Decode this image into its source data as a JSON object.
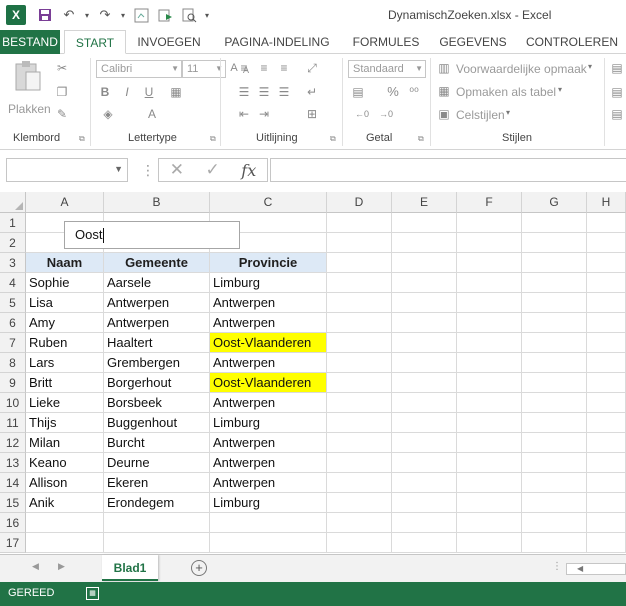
{
  "title_bar": {
    "window_title": "DynamischZoeken.xlsx - Excel",
    "qat_icons": [
      "excel-logo",
      "save-icon",
      "undo-icon",
      "redo-icon",
      "camera-icon",
      "macro-icon",
      "print-preview-icon"
    ]
  },
  "ribbon_tabs": [
    {
      "label": "BESTAND",
      "file": true
    },
    {
      "label": "START",
      "active": true
    },
    {
      "label": "INVOEGEN"
    },
    {
      "label": "PAGINA-INDELING"
    },
    {
      "label": "FORMULES"
    },
    {
      "label": "GEGEVENS"
    },
    {
      "label": "CONTROLEREN"
    }
  ],
  "ribbon": {
    "clipboard": {
      "paste": "Plakken",
      "group": "Klembord"
    },
    "font": {
      "name": "Calibri",
      "size": "11",
      "bold": "B",
      "italic": "I",
      "underline": "U",
      "group": "Lettertype"
    },
    "alignment": {
      "group": "Uitlijning"
    },
    "number": {
      "format": "Standaard",
      "percent": "%",
      "group": "Getal"
    },
    "styles": {
      "conditional": "Voorwaardelijke opmaak",
      "as_table": "Opmaken als tabel",
      "cell_styles": "Celstijlen",
      "group": "Stijlen"
    }
  },
  "formula_bar": {
    "name_box": "",
    "formula": "",
    "fx": "fx"
  },
  "columns": [
    "A",
    "B",
    "C",
    "D",
    "E",
    "F",
    "G",
    "H"
  ],
  "rows": [
    "1",
    "2",
    "3",
    "4",
    "5",
    "6",
    "7",
    "8",
    "9",
    "10",
    "11",
    "12",
    "13",
    "14",
    "15",
    "16",
    "17"
  ],
  "search_box": {
    "value": "Oost"
  },
  "table": {
    "headers": [
      "Naam",
      "Gemeente",
      "Provincie"
    ],
    "rows": [
      {
        "naam": "Sophie",
        "gemeente": "Aarsele",
        "provincie": "Limburg",
        "highlight": false
      },
      {
        "naam": "Lisa",
        "gemeente": "Antwerpen",
        "provincie": "Antwerpen",
        "highlight": false
      },
      {
        "naam": "Amy",
        "gemeente": "Antwerpen",
        "provincie": "Antwerpen",
        "highlight": false
      },
      {
        "naam": "Ruben",
        "gemeente": "Haaltert",
        "provincie": "Oost-Vlaanderen",
        "highlight": true
      },
      {
        "naam": "Lars",
        "gemeente": "Grembergen",
        "provincie": "Antwerpen",
        "highlight": false
      },
      {
        "naam": "Britt",
        "gemeente": "Borgerhout",
        "provincie": "Oost-Vlaanderen",
        "highlight": true
      },
      {
        "naam": "Lieke",
        "gemeente": "Borsbeek",
        "provincie": "Antwerpen",
        "highlight": false
      },
      {
        "naam": "Thijs",
        "gemeente": "Buggenhout",
        "provincie": "Limburg",
        "highlight": false
      },
      {
        "naam": "Milan",
        "gemeente": "Burcht",
        "provincie": "Antwerpen",
        "highlight": false
      },
      {
        "naam": "Keano",
        "gemeente": "Deurne",
        "provincie": "Antwerpen",
        "highlight": false
      },
      {
        "naam": "Allison",
        "gemeente": "Ekeren",
        "provincie": "Antwerpen",
        "highlight": false
      },
      {
        "naam": "Anik",
        "gemeente": "Erondegem",
        "provincie": "Limburg",
        "highlight": false
      }
    ]
  },
  "sheet_tabs": [
    {
      "label": "Blad1",
      "active": true
    }
  ],
  "status_bar": {
    "status": "GEREED"
  },
  "colors": {
    "excel_green": "#217346",
    "header_fill": "#dde9f6",
    "highlight": "#ffff00"
  }
}
